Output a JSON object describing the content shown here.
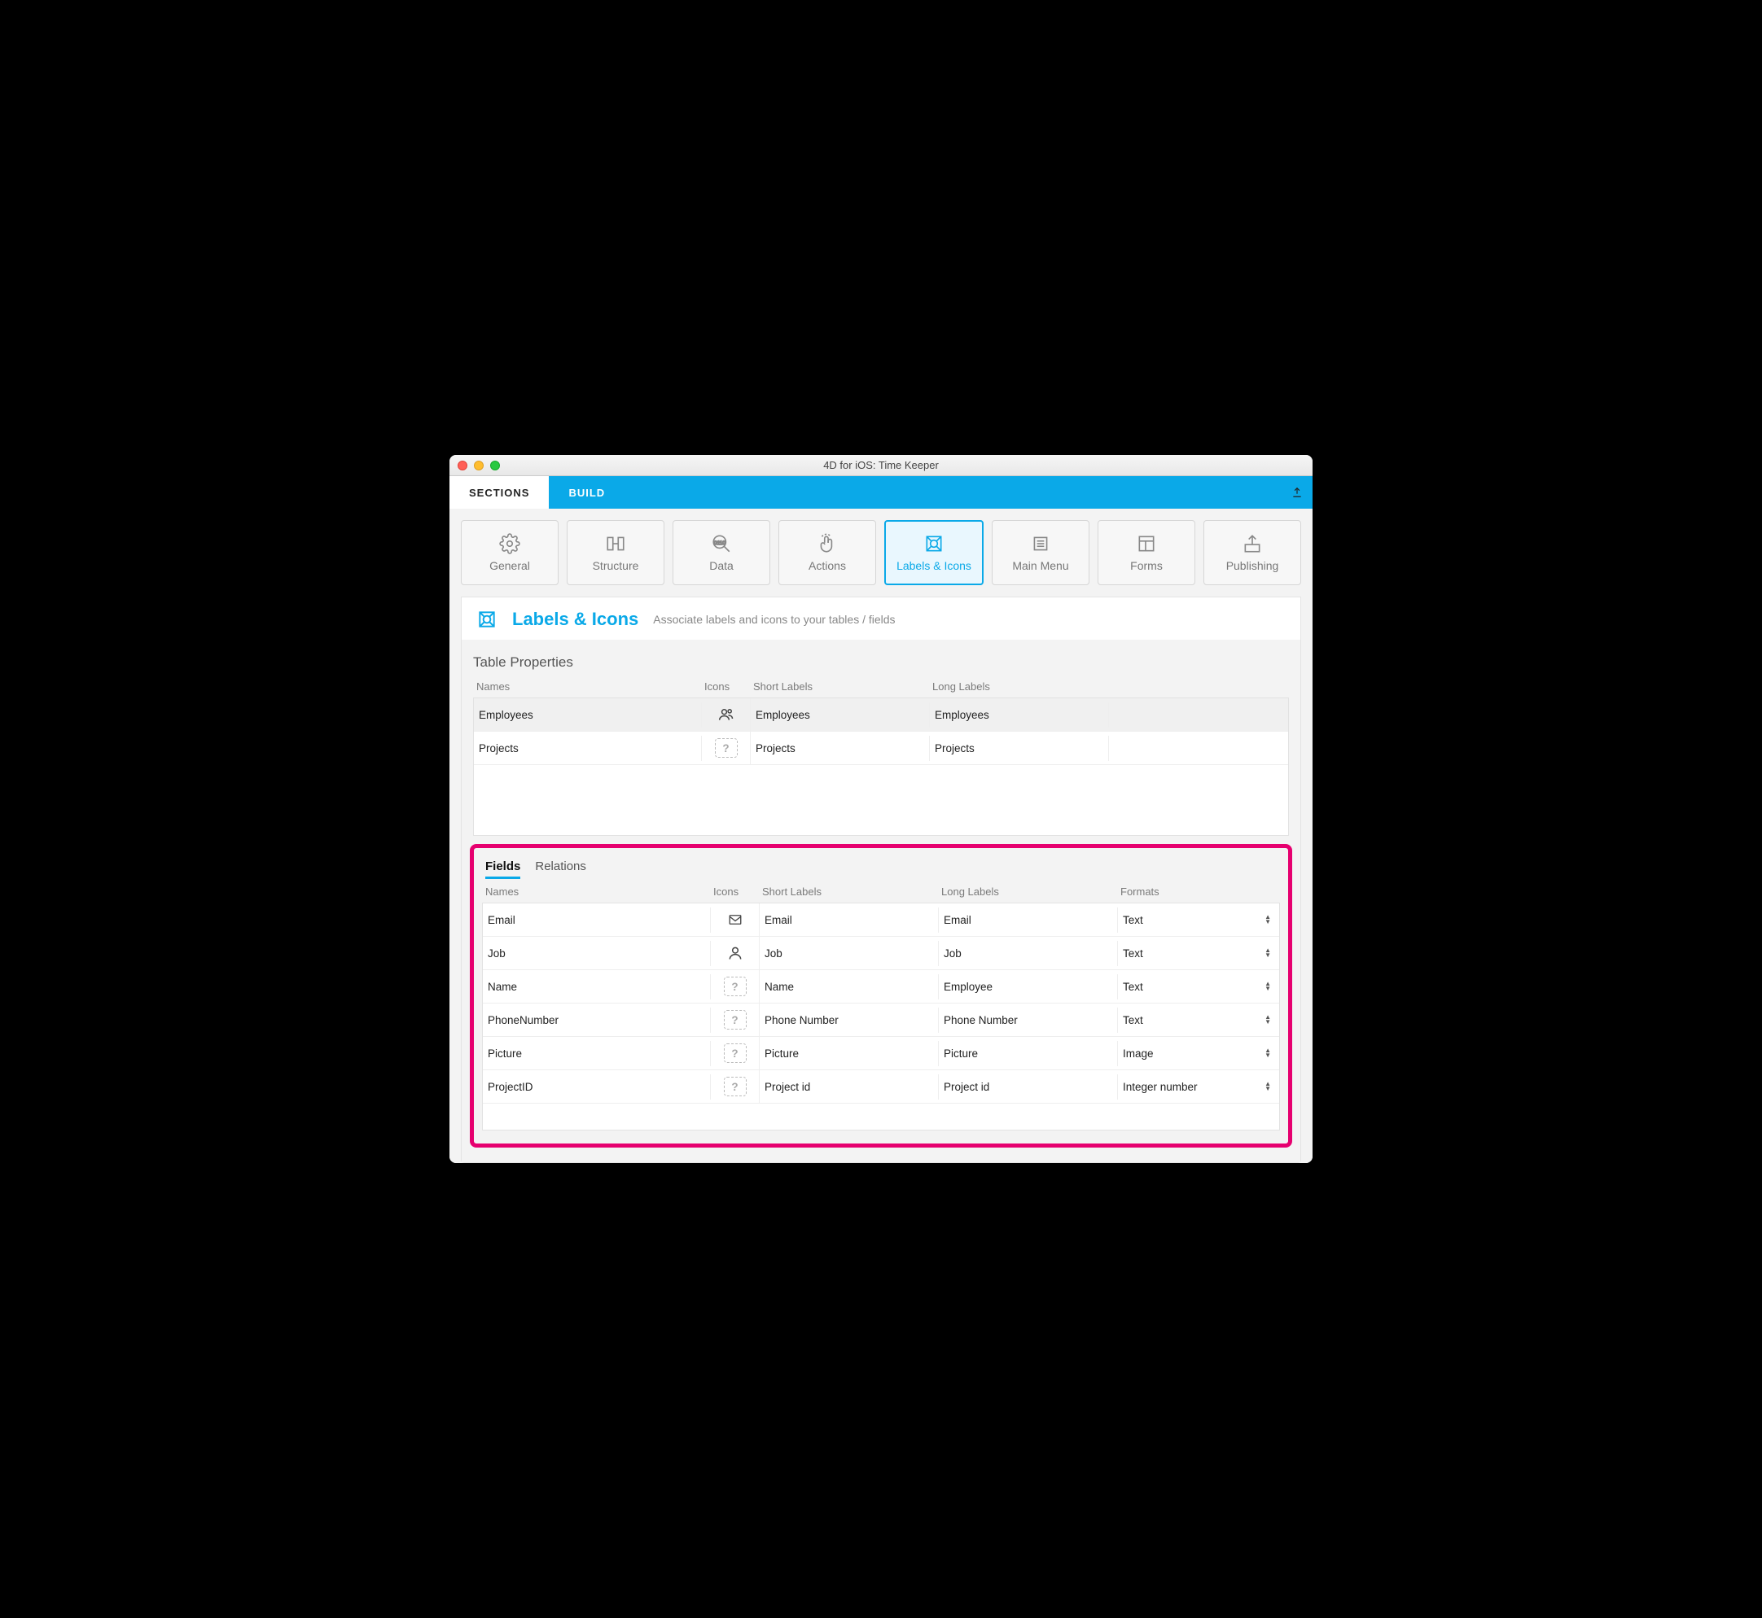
{
  "window": {
    "title": "4D for iOS: Time Keeper"
  },
  "topnav": {
    "sections": "SECTIONS",
    "build": "BUILD"
  },
  "tiles": [
    {
      "id": "general",
      "label": "General"
    },
    {
      "id": "structure",
      "label": "Structure"
    },
    {
      "id": "data",
      "label": "Data"
    },
    {
      "id": "actions",
      "label": "Actions"
    },
    {
      "id": "labels",
      "label": "Labels & Icons",
      "active": true
    },
    {
      "id": "mainmenu",
      "label": "Main Menu"
    },
    {
      "id": "forms",
      "label": "Forms"
    },
    {
      "id": "publishing",
      "label": "Publishing"
    }
  ],
  "panel": {
    "title": "Labels & Icons",
    "desc": "Associate labels and icons to your tables / fields"
  },
  "tableprops": {
    "title": "Table Properties",
    "headers": {
      "names": "Names",
      "icons": "Icons",
      "short": "Short Labels",
      "long": "Long Labels"
    },
    "rows": [
      {
        "name": "Employees",
        "icon": "people",
        "short": "Employees",
        "long": "Employees",
        "selected": true
      },
      {
        "name": "Projects",
        "icon": "?",
        "short": "Projects",
        "long": "Projects"
      }
    ]
  },
  "subtabs": {
    "fields": "Fields",
    "relations": "Relations"
  },
  "fieldprops": {
    "headers": {
      "names": "Names",
      "icons": "Icons",
      "short": "Short Labels",
      "long": "Long Labels",
      "formats": "Formats"
    },
    "rows": [
      {
        "name": "Email",
        "icon": "mail",
        "short": "Email",
        "long": "Email",
        "format": "Text"
      },
      {
        "name": "Job",
        "icon": "person",
        "short": "Job",
        "long": "Job",
        "format": "Text"
      },
      {
        "name": "Name",
        "icon": "?",
        "short": "Name",
        "long": "Employee",
        "format": "Text"
      },
      {
        "name": "PhoneNumber",
        "icon": "?",
        "short": "Phone Number",
        "long": "Phone Number",
        "format": "Text"
      },
      {
        "name": "Picture",
        "icon": "?",
        "short": "Picture",
        "long": "Picture",
        "format": "Image"
      },
      {
        "name": "ProjectID",
        "icon": "?",
        "short": "Project id",
        "long": "Project id",
        "format": "Integer number"
      }
    ]
  }
}
